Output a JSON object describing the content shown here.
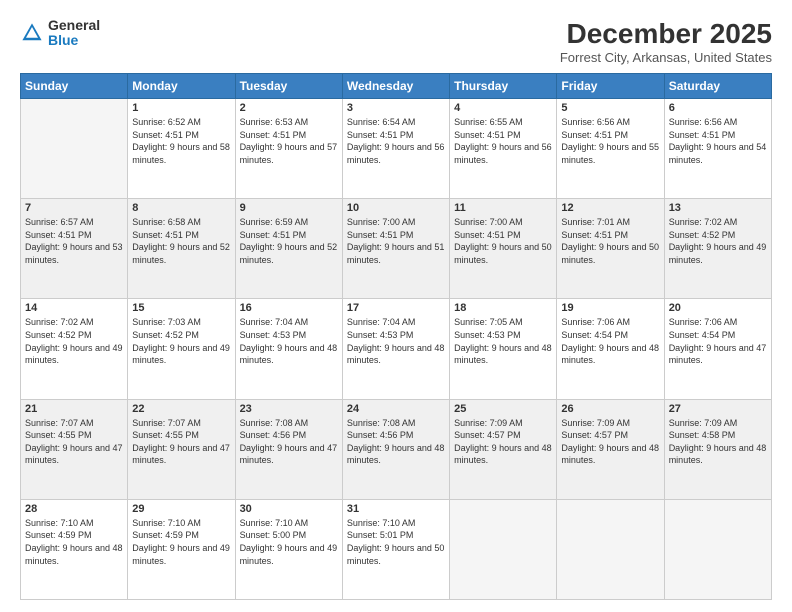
{
  "logo": {
    "general": "General",
    "blue": "Blue"
  },
  "header": {
    "title": "December 2025",
    "location": "Forrest City, Arkansas, United States"
  },
  "weekdays": [
    "Sunday",
    "Monday",
    "Tuesday",
    "Wednesday",
    "Thursday",
    "Friday",
    "Saturday"
  ],
  "weeks": [
    [
      {
        "day": "",
        "empty": true
      },
      {
        "day": "1",
        "sunrise": "6:52 AM",
        "sunset": "4:51 PM",
        "daylight": "9 hours and 58 minutes."
      },
      {
        "day": "2",
        "sunrise": "6:53 AM",
        "sunset": "4:51 PM",
        "daylight": "9 hours and 57 minutes."
      },
      {
        "day": "3",
        "sunrise": "6:54 AM",
        "sunset": "4:51 PM",
        "daylight": "9 hours and 56 minutes."
      },
      {
        "day": "4",
        "sunrise": "6:55 AM",
        "sunset": "4:51 PM",
        "daylight": "9 hours and 56 minutes."
      },
      {
        "day": "5",
        "sunrise": "6:56 AM",
        "sunset": "4:51 PM",
        "daylight": "9 hours and 55 minutes."
      },
      {
        "day": "6",
        "sunrise": "6:56 AM",
        "sunset": "4:51 PM",
        "daylight": "9 hours and 54 minutes."
      }
    ],
    [
      {
        "day": "7",
        "sunrise": "6:57 AM",
        "sunset": "4:51 PM",
        "daylight": "9 hours and 53 minutes."
      },
      {
        "day": "8",
        "sunrise": "6:58 AM",
        "sunset": "4:51 PM",
        "daylight": "9 hours and 52 minutes."
      },
      {
        "day": "9",
        "sunrise": "6:59 AM",
        "sunset": "4:51 PM",
        "daylight": "9 hours and 52 minutes."
      },
      {
        "day": "10",
        "sunrise": "7:00 AM",
        "sunset": "4:51 PM",
        "daylight": "9 hours and 51 minutes."
      },
      {
        "day": "11",
        "sunrise": "7:00 AM",
        "sunset": "4:51 PM",
        "daylight": "9 hours and 50 minutes."
      },
      {
        "day": "12",
        "sunrise": "7:01 AM",
        "sunset": "4:51 PM",
        "daylight": "9 hours and 50 minutes."
      },
      {
        "day": "13",
        "sunrise": "7:02 AM",
        "sunset": "4:52 PM",
        "daylight": "9 hours and 49 minutes."
      }
    ],
    [
      {
        "day": "14",
        "sunrise": "7:02 AM",
        "sunset": "4:52 PM",
        "daylight": "9 hours and 49 minutes."
      },
      {
        "day": "15",
        "sunrise": "7:03 AM",
        "sunset": "4:52 PM",
        "daylight": "9 hours and 49 minutes."
      },
      {
        "day": "16",
        "sunrise": "7:04 AM",
        "sunset": "4:53 PM",
        "daylight": "9 hours and 48 minutes."
      },
      {
        "day": "17",
        "sunrise": "7:04 AM",
        "sunset": "4:53 PM",
        "daylight": "9 hours and 48 minutes."
      },
      {
        "day": "18",
        "sunrise": "7:05 AM",
        "sunset": "4:53 PM",
        "daylight": "9 hours and 48 minutes."
      },
      {
        "day": "19",
        "sunrise": "7:06 AM",
        "sunset": "4:54 PM",
        "daylight": "9 hours and 48 minutes."
      },
      {
        "day": "20",
        "sunrise": "7:06 AM",
        "sunset": "4:54 PM",
        "daylight": "9 hours and 47 minutes."
      }
    ],
    [
      {
        "day": "21",
        "sunrise": "7:07 AM",
        "sunset": "4:55 PM",
        "daylight": "9 hours and 47 minutes."
      },
      {
        "day": "22",
        "sunrise": "7:07 AM",
        "sunset": "4:55 PM",
        "daylight": "9 hours and 47 minutes."
      },
      {
        "day": "23",
        "sunrise": "7:08 AM",
        "sunset": "4:56 PM",
        "daylight": "9 hours and 47 minutes."
      },
      {
        "day": "24",
        "sunrise": "7:08 AM",
        "sunset": "4:56 PM",
        "daylight": "9 hours and 48 minutes."
      },
      {
        "day": "25",
        "sunrise": "7:09 AM",
        "sunset": "4:57 PM",
        "daylight": "9 hours and 48 minutes."
      },
      {
        "day": "26",
        "sunrise": "7:09 AM",
        "sunset": "4:57 PM",
        "daylight": "9 hours and 48 minutes."
      },
      {
        "day": "27",
        "sunrise": "7:09 AM",
        "sunset": "4:58 PM",
        "daylight": "9 hours and 48 minutes."
      }
    ],
    [
      {
        "day": "28",
        "sunrise": "7:10 AM",
        "sunset": "4:59 PM",
        "daylight": "9 hours and 48 minutes."
      },
      {
        "day": "29",
        "sunrise": "7:10 AM",
        "sunset": "4:59 PM",
        "daylight": "9 hours and 49 minutes."
      },
      {
        "day": "30",
        "sunrise": "7:10 AM",
        "sunset": "5:00 PM",
        "daylight": "9 hours and 49 minutes."
      },
      {
        "day": "31",
        "sunrise": "7:10 AM",
        "sunset": "5:01 PM",
        "daylight": "9 hours and 50 minutes."
      },
      {
        "day": "",
        "empty": true
      },
      {
        "day": "",
        "empty": true
      },
      {
        "day": "",
        "empty": true
      }
    ]
  ]
}
